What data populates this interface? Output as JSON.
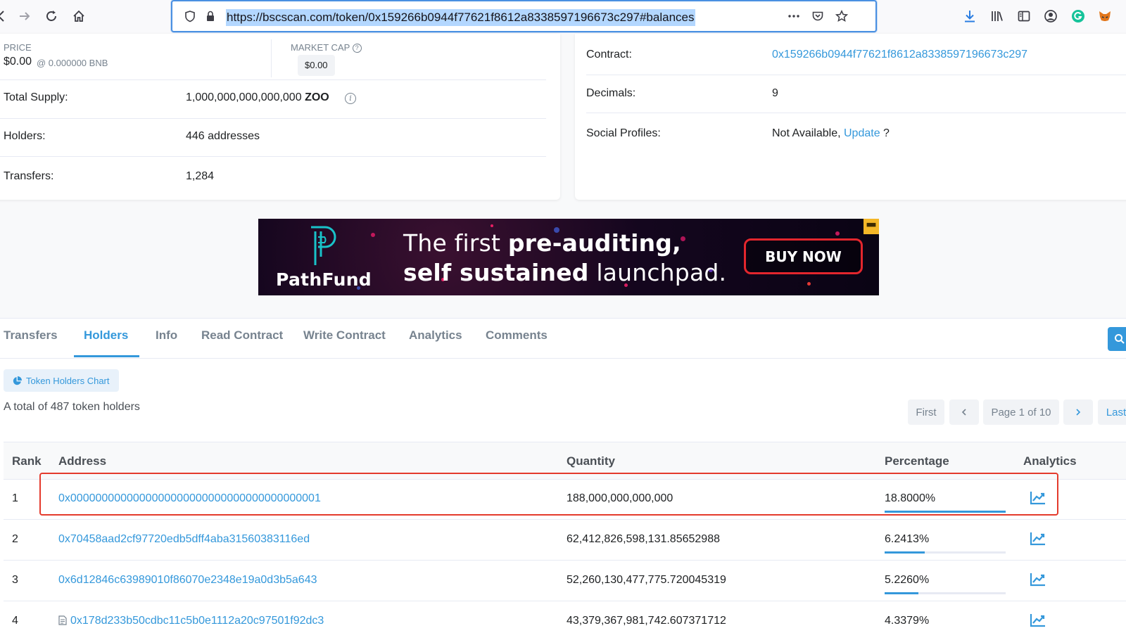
{
  "browser": {
    "url": "https://bscscan.com/token/0x159266b0944f77621f8612a8338597196673c297#balances"
  },
  "overview": {
    "price_label": "PRICE",
    "price_value": "$0.00",
    "price_bnb": "@ 0.000000 BNB",
    "market_cap_label": "MARKET CAP",
    "market_cap_value": "$0.00",
    "total_supply_label": "Total Supply:",
    "total_supply_value": "1,000,000,000,000,000",
    "total_supply_symbol": "ZOO",
    "holders_label": "Holders:",
    "holders_value": "446 addresses",
    "transfers_label": "Transfers:",
    "transfers_value": "1,284"
  },
  "profile": {
    "contract_label": "Contract:",
    "contract_value": "0x159266b0944f77621f8612a8338597196673c297",
    "decimals_label": "Decimals:",
    "decimals_value": "9",
    "social_label": "Social Profiles:",
    "social_value": "Not Available,",
    "social_update": "Update",
    "social_suffix": "?"
  },
  "ad": {
    "brand": "PathFund",
    "headline_1a": "The first ",
    "headline_1b": "pre-auditing,",
    "headline_2a": "self sustained",
    "headline_2b": " launchpad.",
    "cta": "BUY NOW",
    "colors": {
      "cta_border": "#e3262d",
      "logo": "#19c2c9"
    }
  },
  "tabs": [
    {
      "label": "Transfers"
    },
    {
      "label": "Holders",
      "active": true
    },
    {
      "label": "Info"
    },
    {
      "label": "Read Contract"
    },
    {
      "label": "Write Contract"
    },
    {
      "label": "Analytics"
    },
    {
      "label": "Comments"
    }
  ],
  "holders": {
    "chart_button": "Token Holders Chart",
    "total_text": "A total of 487 token holders",
    "pager": {
      "first": "First",
      "prev": "<",
      "page": "Page 1 of 10",
      "next": ">",
      "last": "Last"
    },
    "columns": [
      "Rank",
      "Address",
      "Quantity",
      "Percentage",
      "Analytics"
    ],
    "rows": [
      {
        "rank": "1",
        "address": "0x0000000000000000000000000000000000000001",
        "quantity": "188,000,000,000,000",
        "percentage": "18.8000%",
        "pct": 18.8,
        "contract": false
      },
      {
        "rank": "2",
        "address": "0x70458aad2cf97720edb5dff4aba31560383116ed",
        "quantity": "62,412,826,598,131.85652988",
        "percentage": "6.2413%",
        "pct": 6.2413,
        "contract": false
      },
      {
        "rank": "3",
        "address": "0x6d12846c63989010f86070e2348e19a0d3b5a643",
        "quantity": "52,260,130,477,775.720045319",
        "percentage": "5.2260%",
        "pct": 5.226,
        "contract": false
      },
      {
        "rank": "4",
        "address": "0x178d233b50cdbc11c5b0e1112a20c97501f92dc3",
        "quantity": "43,379,367,981,742.607371712",
        "percentage": "4.3379%",
        "pct": 4.3379,
        "contract": true
      }
    ]
  },
  "colors": {
    "accent": "#3498db",
    "highlight": "#e43a2c"
  }
}
